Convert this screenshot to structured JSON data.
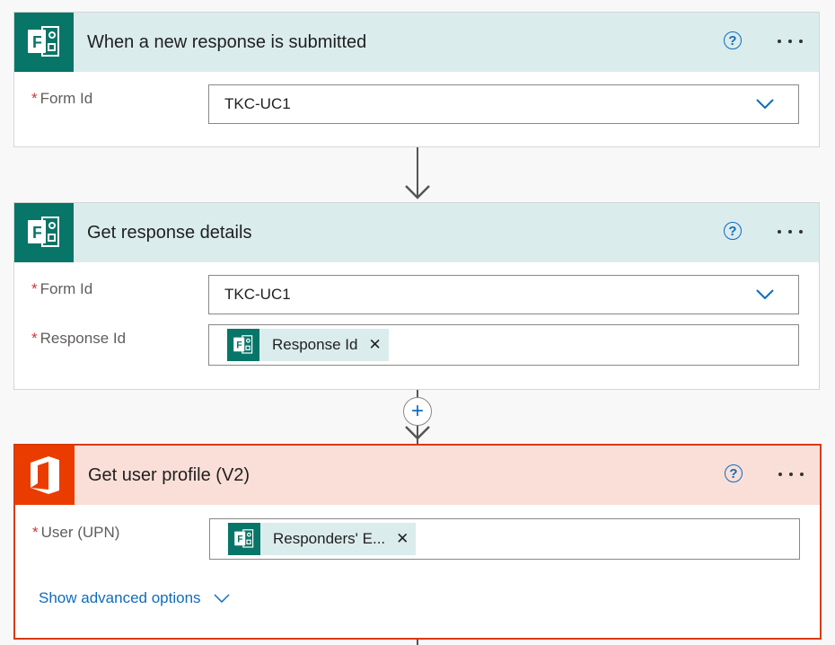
{
  "cards": [
    {
      "title": "When a new response is submitted",
      "icon": "forms-icon",
      "fields": [
        {
          "label": "Form Id",
          "required": "*",
          "value": "TKC-UC1"
        }
      ]
    },
    {
      "title": "Get response details",
      "icon": "forms-icon",
      "fields": [
        {
          "label": "Form Id",
          "required": "*",
          "value": "TKC-UC1"
        },
        {
          "label": "Response Id",
          "required": "*",
          "token": "Response Id"
        }
      ]
    },
    {
      "title": "Get user profile (V2)",
      "icon": "office-icon",
      "fields": [
        {
          "label": "User (UPN)",
          "required": "*",
          "token": "Responders' E..."
        }
      ],
      "advanced": "Show advanced options"
    }
  ],
  "colors": {
    "forms_teal": "#077568",
    "office_orange": "#eb3c00",
    "header_teal": "#dbecec",
    "header_selected": "#fadfd8",
    "link_blue": "#0f6cbd"
  }
}
